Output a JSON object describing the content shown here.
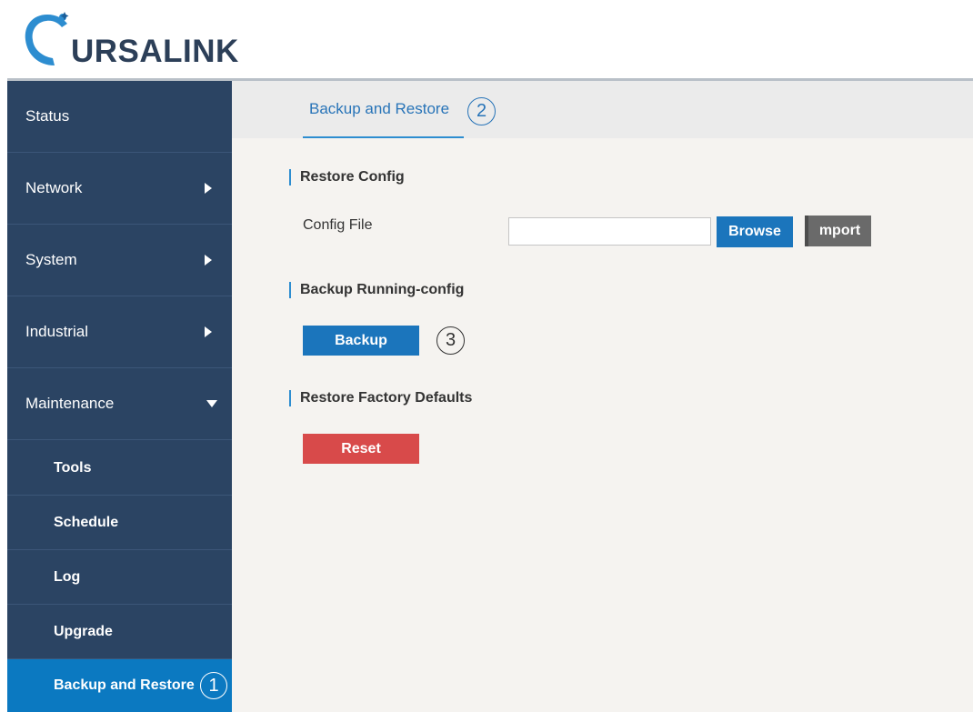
{
  "brand": {
    "name": "URSALINK",
    "logo_text": "URSALINK",
    "color": "#2c3f58"
  },
  "sidebar": {
    "items": [
      {
        "label": "Status",
        "arrow": "none"
      },
      {
        "label": "Network",
        "arrow": "caret-right-icon"
      },
      {
        "label": "System",
        "arrow": "caret-right-icon"
      },
      {
        "label": "Industrial",
        "arrow": "caret-right-icon"
      },
      {
        "label": "Maintenance",
        "arrow": "caret-down-icon",
        "expanded": true
      }
    ],
    "subitems": [
      {
        "label": "Tools"
      },
      {
        "label": "Schedule"
      },
      {
        "label": "Log"
      },
      {
        "label": "Upgrade"
      },
      {
        "label": "Backup and Restore",
        "active": true,
        "marker": "①"
      }
    ],
    "background": "#2b4463",
    "active_color": "#0b79c1"
  },
  "main": {
    "tab": {
      "label": "Backup and Restore",
      "marker": "②"
    },
    "restore_config": {
      "title": "Restore Config",
      "field_label": "Config File",
      "file_value": "",
      "browse_label": "Browse",
      "import_label": "mport"
    },
    "backup": {
      "title": "Backup Running-config",
      "button_label": "Backup",
      "marker": "③"
    },
    "factory": {
      "title": "Restore Factory Defaults",
      "button_label": "Reset"
    }
  },
  "colors": {
    "accent": "#1b75bc",
    "danger": "#d84a4a",
    "disabled": "#6a6a6a"
  }
}
